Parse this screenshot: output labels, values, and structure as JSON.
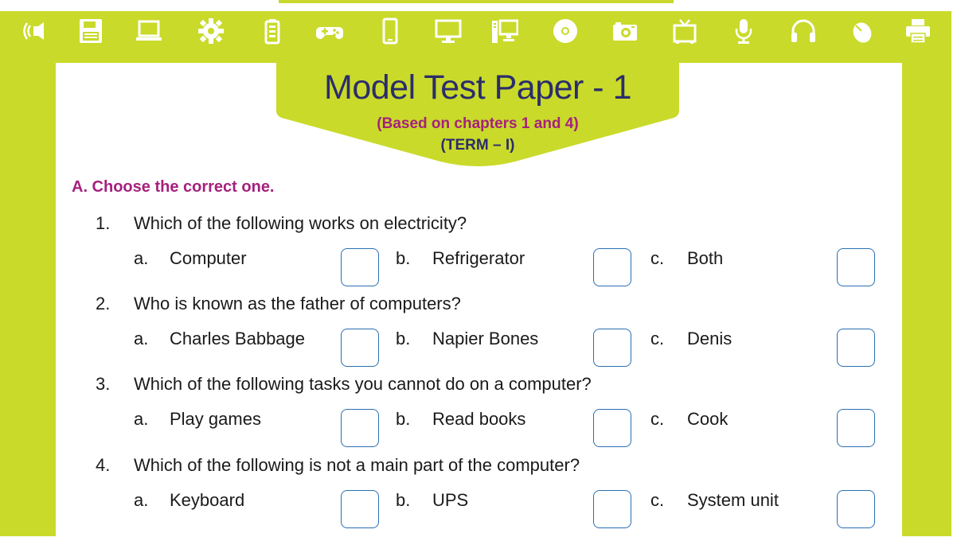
{
  "header": {
    "icons": [
      "speaker-icon",
      "floppy-disk-icon",
      "laptop-icon",
      "gear-icon",
      "battery-icon",
      "gamepad-icon",
      "mobile-phone-icon",
      "monitor-icon",
      "desktop-computer-icon",
      "cd-icon",
      "camera-icon",
      "television-icon",
      "microphone-icon",
      "headphones-icon",
      "mouse-icon",
      "printer-icon"
    ]
  },
  "title": "Model Test Paper - 1",
  "subtitle": "(Based on chapters 1 and 4)",
  "term": "(TERM – I)",
  "section_heading": "A. Choose the correct one.",
  "questions": [
    {
      "num": "1.",
      "text": "Which of the following works on electricity?",
      "options": [
        {
          "letter": "a.",
          "text": "Computer"
        },
        {
          "letter": "b.",
          "text": "Refrigerator"
        },
        {
          "letter": "c.",
          "text": "Both"
        }
      ]
    },
    {
      "num": "2.",
      "text": "Who is known as the father of computers?",
      "options": [
        {
          "letter": "a.",
          "text": "Charles Babbage"
        },
        {
          "letter": "b.",
          "text": "Napier Bones"
        },
        {
          "letter": "c.",
          "text": "Denis"
        }
      ]
    },
    {
      "num": "3.",
      "text": "Which of the following tasks you cannot do on a computer?",
      "options": [
        {
          "letter": "a.",
          "text": "Play games"
        },
        {
          "letter": "b.",
          "text": "Read books"
        },
        {
          "letter": "c.",
          "text": "Cook"
        }
      ]
    },
    {
      "num": "4.",
      "text": "Which of the following is not a main part of the computer?",
      "options": [
        {
          "letter": "a.",
          "text": "Keyboard"
        },
        {
          "letter": "b.",
          "text": "UPS"
        },
        {
          "letter": "c.",
          "text": "System unit"
        }
      ]
    }
  ],
  "colors": {
    "frame": "#c9da2a",
    "title": "#2b2d6b",
    "accent": "#a5217d",
    "checkbox_border": "#2b6fb3"
  }
}
